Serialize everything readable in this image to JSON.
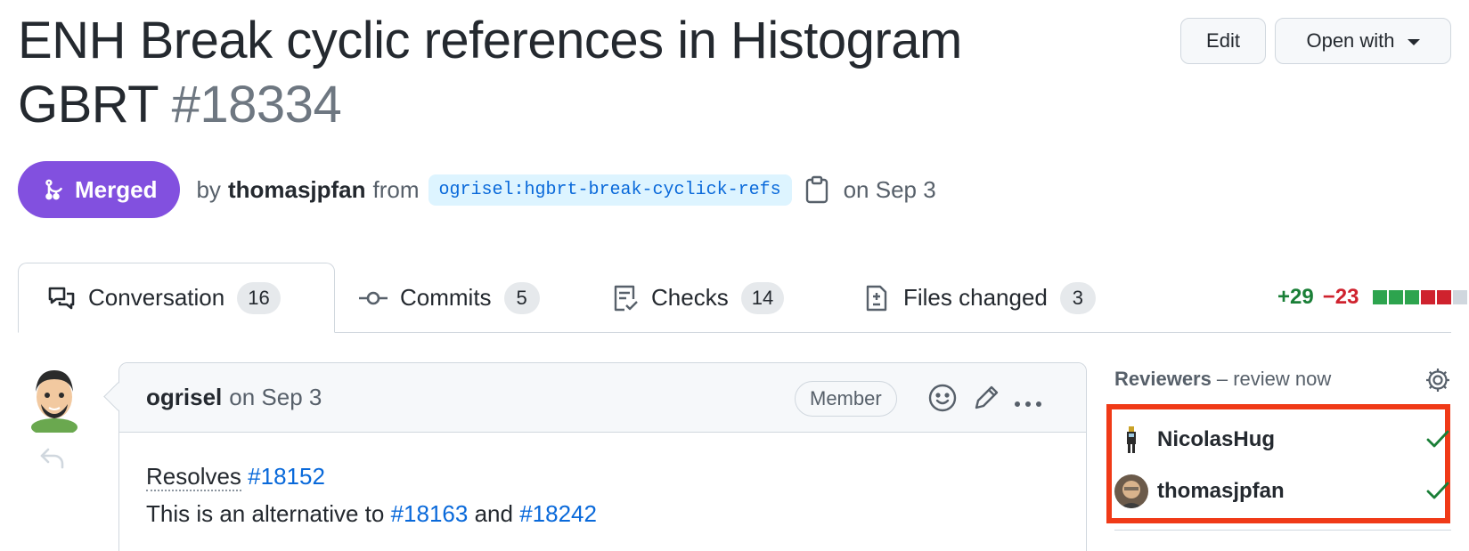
{
  "pr": {
    "title": "ENH Break cyclic references in Histogram GBRT",
    "number": "#18334",
    "status": "Merged",
    "by_label": "by",
    "author": "thomasjpfan",
    "from_label": "from",
    "branch": "ogrisel:hgbrt-break-cyclick-refs",
    "date": "on Sep 3"
  },
  "header_buttons": {
    "edit": "Edit",
    "open_with": "Open with"
  },
  "tabs": [
    {
      "label": "Conversation",
      "count": "16",
      "icon": "comment-discussion-icon"
    },
    {
      "label": "Commits",
      "count": "5",
      "icon": "commit-icon"
    },
    {
      "label": "Checks",
      "count": "14",
      "icon": "checklist-icon"
    },
    {
      "label": "Files changed",
      "count": "3",
      "icon": "file-diff-icon"
    }
  ],
  "diffstat": {
    "additions": "+29",
    "deletions": "−23",
    "blocks": [
      "#2da44e",
      "#2da44e",
      "#2da44e",
      "#cf222e",
      "#cf222e",
      "#d0d7de"
    ]
  },
  "comment": {
    "author": "ogrisel",
    "date": "on Sep 3",
    "role": "Member",
    "line1_prefix": "Resolves",
    "line1_link": "#18152",
    "line2_prefix": "This is an alternative to",
    "line2_link1": "#18163",
    "line2_and": "and",
    "line2_link2": "#18242"
  },
  "reviewers": {
    "title": "Reviewers",
    "subtitle": "– review now",
    "items": [
      {
        "name": "NicolasHug",
        "status": "approved"
      },
      {
        "name": "thomasjpfan",
        "status": "approved"
      }
    ]
  },
  "colors": {
    "merged": "#8250df",
    "link": "#0969da",
    "highlight_box": "#f03a17",
    "approved": "#1a7f37"
  }
}
